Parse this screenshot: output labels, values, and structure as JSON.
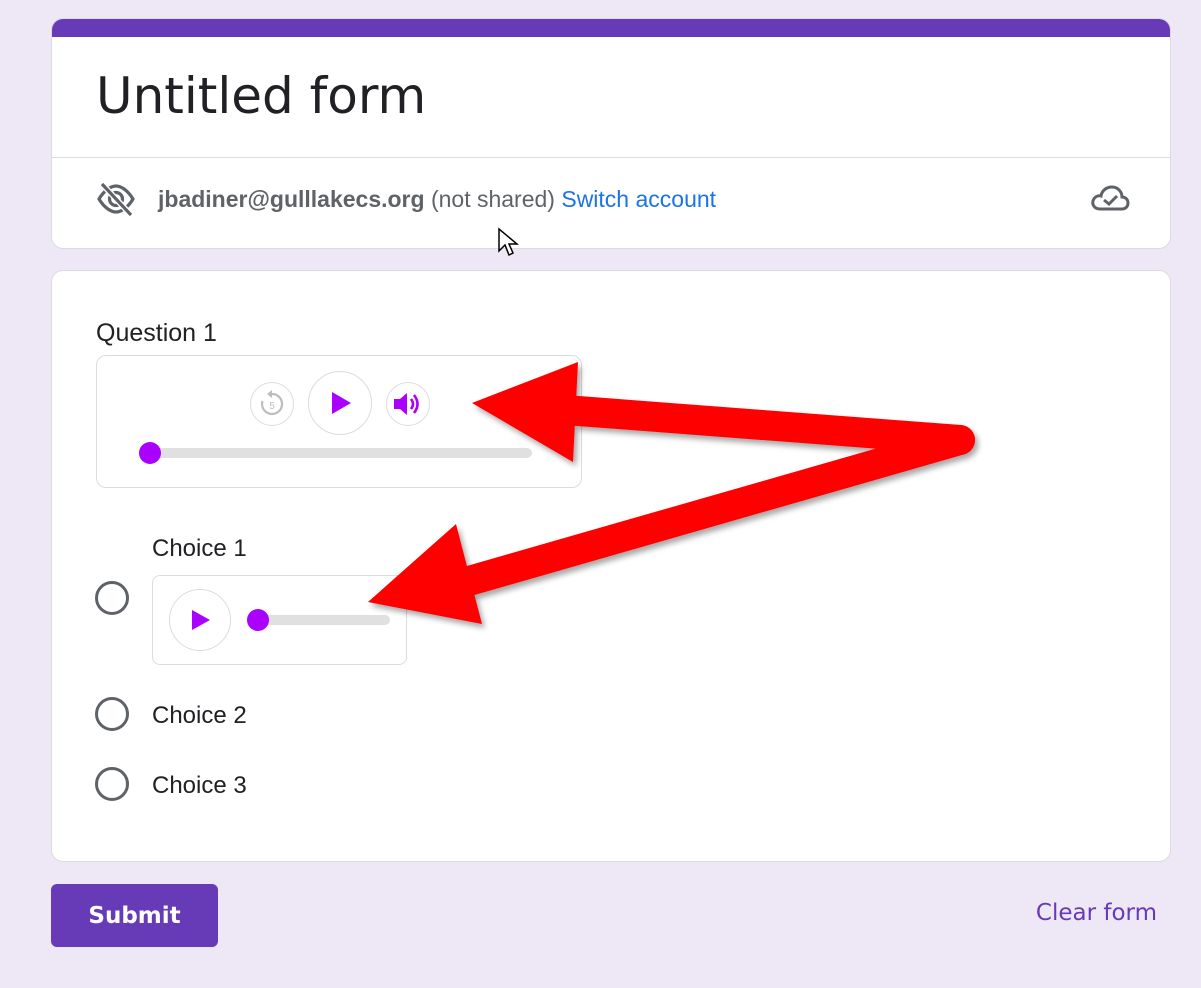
{
  "form": {
    "title": "Untitled form",
    "accent_color": "#673ab7",
    "account": {
      "email": "jbadiner@gulllakecs.org",
      "status": " (not shared) ",
      "switch_label": "Switch account"
    },
    "icons": [
      "eye-off-icon",
      "cloud-saved-icon"
    ]
  },
  "question": {
    "title": "Question 1",
    "audio_player": {
      "replay_seconds": "5",
      "progress": 0,
      "accent_color": "#aa00ff"
    },
    "choices": [
      {
        "label": "Choice 1",
        "has_audio": true,
        "audio_progress": 0
      },
      {
        "label": "Choice 2",
        "has_audio": false
      },
      {
        "label": "Choice 3",
        "has_audio": false
      }
    ]
  },
  "actions": {
    "submit_label": "Submit",
    "clear_label": "Clear form"
  },
  "annotations": {
    "arrow_color": "#ff0000"
  }
}
